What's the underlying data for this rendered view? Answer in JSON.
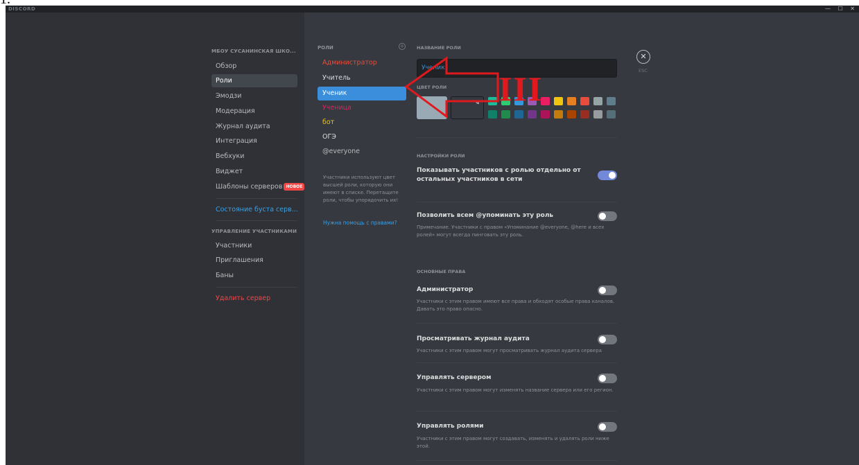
{
  "step_label": "1.",
  "titlebar": {
    "brand": "DISCORD",
    "minimize": "—",
    "maximize": "☐",
    "close": "✕"
  },
  "sidebar": {
    "server_heading": "МБОУ СУСАНИНСКАЯ ШКО...",
    "items": [
      {
        "label": "Обзор"
      },
      {
        "label": "Роли"
      },
      {
        "label": "Эмодзи"
      },
      {
        "label": "Модерация"
      },
      {
        "label": "Журнал аудита"
      },
      {
        "label": "Интеграция"
      },
      {
        "label": "Вебхуки"
      },
      {
        "label": "Виджет"
      },
      {
        "label": "Шаблоны серверов",
        "badge": "НОВОЕ"
      }
    ],
    "boost_status": "Состояние буста серв...",
    "members_heading": "УПРАВЛЕНИЕ УЧАСТНИКАМИ",
    "member_items": [
      {
        "label": "Участники"
      },
      {
        "label": "Приглашения"
      },
      {
        "label": "Баны"
      }
    ],
    "delete_server": "Удалить сервер"
  },
  "roles": {
    "heading": "РОЛИ",
    "add_icon": "plus-icon",
    "list": [
      {
        "label": "Администратор",
        "color": "#e74c3c"
      },
      {
        "label": "Учитель",
        "color": "#dcddde"
      },
      {
        "label": "Ученик",
        "color": "#ffffff"
      },
      {
        "label": "Ученица",
        "color": "#e91e63"
      },
      {
        "label": "бот",
        "color": "#f1c40f"
      },
      {
        "label": "ОГЭ",
        "color": "#dcddde"
      },
      {
        "label": "@everyone",
        "color": "#b9bbbe"
      }
    ],
    "hint": "Участники используют цвет высшей роли, которую они имеют в списке. Перетащите роли, чтобы упорядочить их!",
    "help_link": "Нужна помощь с правами?"
  },
  "role_settings": {
    "name_heading": "НАЗВАНИЕ РОЛИ",
    "name_value": "Ученик",
    "color_heading": "ЦВЕТ РОЛИ",
    "selected_color": "#99aab5",
    "swatches_row1": [
      "#1abc9c",
      "#2ecc71",
      "#3498db",
      "#9b59b6",
      "#e91e63",
      "#f1c40f",
      "#e67e22",
      "#e74c3c",
      "#95a5a6",
      "#607d8b"
    ],
    "swatches_row2": [
      "#11806a",
      "#1f8b4c",
      "#206694",
      "#71368a",
      "#ad1457",
      "#c27c0e",
      "#a84300",
      "#992d22",
      "#979c9f",
      "#546e7a"
    ],
    "settings_heading": "НАСТРОЙКИ РОЛИ",
    "perms_heading": "ОСНОВНЫЕ ПРАВА",
    "toggles": [
      {
        "title": "Показывать участников с ролью отдельно от остальных участников в сети",
        "desc": "",
        "on": true
      },
      {
        "title": "Позволить всем @упоминать эту роль",
        "desc": "Примечание. Участники с правом «Упоминание @everyone, @here и всех ролей» могут всегда пинговать эту роль.",
        "on": false
      }
    ],
    "permissions": [
      {
        "title": "Администратор",
        "desc": "Участники с этим правом имеют все права и обходят особые права каналов. Давать это право опасно.",
        "on": false
      },
      {
        "title": "Просматривать журнал аудита",
        "desc": "Участники с этим правом могут просматривать журнал аудита сервера",
        "on": false
      },
      {
        "title": "Управлять сервером",
        "desc": "Участники с этим правом могут изменять название сервера или его регион.",
        "on": false
      },
      {
        "title": "Управлять ролями",
        "desc": "Участники с этим правом могут создавать, изменять и удалять роли ниже этой.",
        "on": false
      }
    ]
  },
  "close": {
    "icon": "close-icon",
    "label": "ESC"
  },
  "annotation": {
    "text": "III",
    "color": "#e0191f"
  }
}
